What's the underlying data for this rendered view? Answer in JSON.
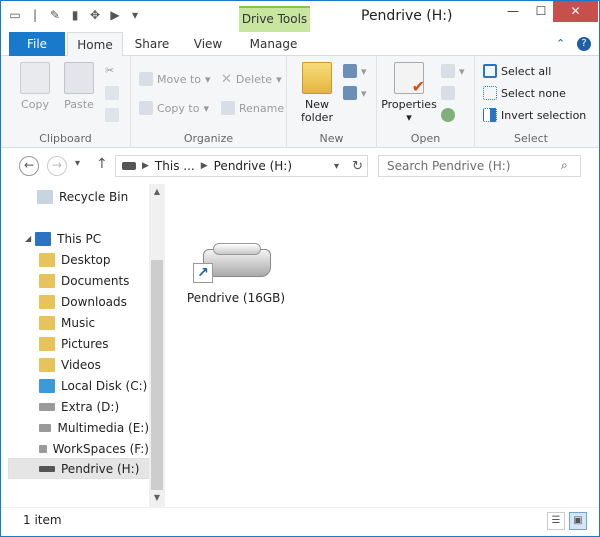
{
  "window": {
    "title": "Pendrive (H:)",
    "context_tab": "Drive Tools"
  },
  "ribbon_tabs": {
    "file": "File",
    "home": "Home",
    "share": "Share",
    "view": "View",
    "manage": "Manage"
  },
  "clipboard": {
    "copy": "Copy",
    "paste": "Paste",
    "label": "Clipboard"
  },
  "organize": {
    "move_to": "Move to",
    "copy_to": "Copy to",
    "delete": "Delete",
    "rename": "Rename",
    "label": "Organize"
  },
  "new": {
    "new_folder_line1": "New",
    "new_folder_line2": "folder",
    "label": "New"
  },
  "open": {
    "properties": "Properties",
    "label": "Open"
  },
  "select": {
    "select_all": "Select all",
    "select_none": "Select none",
    "invert": "Invert selection",
    "label": "Select"
  },
  "address": {
    "this_pc": "This ...",
    "current": "Pendrive (H:)"
  },
  "search": {
    "placeholder": "Search Pendrive (H:)"
  },
  "nav": {
    "recycle_bin": "Recycle Bin",
    "this_pc": "This PC",
    "desktop": "Desktop",
    "documents": "Documents",
    "downloads": "Downloads",
    "music": "Music",
    "pictures": "Pictures",
    "videos": "Videos",
    "local_disk": "Local Disk (C:)",
    "extra": "Extra (D:)",
    "multimedia": "Multimedia (E:)",
    "workspaces": "WorkSpaces (F:)",
    "pendrive": "Pendrive (H:)"
  },
  "content": {
    "item_label": "Pendrive (16GB)"
  },
  "status": {
    "count": "1 item"
  },
  "colors": {
    "accent": "#1979ca",
    "context": "#c8e6a0",
    "close": "#c7504d"
  }
}
